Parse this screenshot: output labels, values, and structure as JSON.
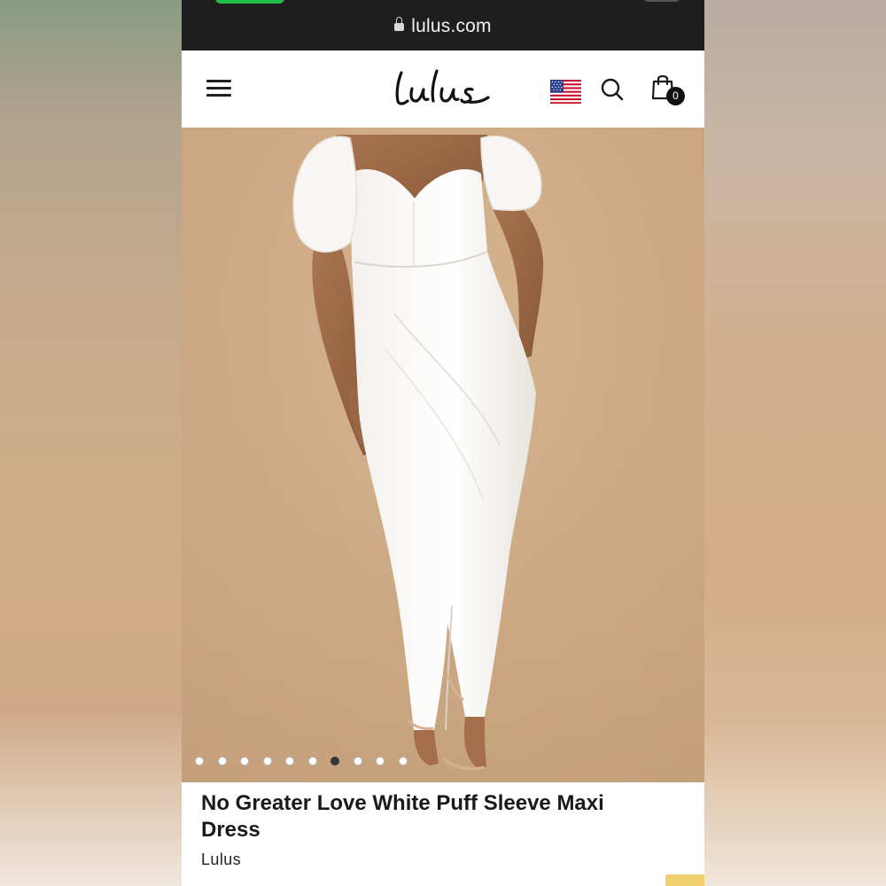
{
  "browser": {
    "url": "lulus.com"
  },
  "header": {
    "logo_text": "Lulus",
    "cart_count": "0",
    "icons": {
      "menu": "menu-icon",
      "flag": "us-flag-icon",
      "search": "search-icon",
      "cart": "shopping-bag-icon"
    }
  },
  "gallery": {
    "image_count": 10,
    "active_index": 6
  },
  "product": {
    "title": "No Greater Love White Puff Sleeve Maxi Dress",
    "brand": "Lulus"
  },
  "colors": {
    "browser_bar": "#1e1e1e",
    "backdrop": "#d0ad88",
    "accent": "#f2cf6e",
    "text": "#1a1a1a"
  }
}
